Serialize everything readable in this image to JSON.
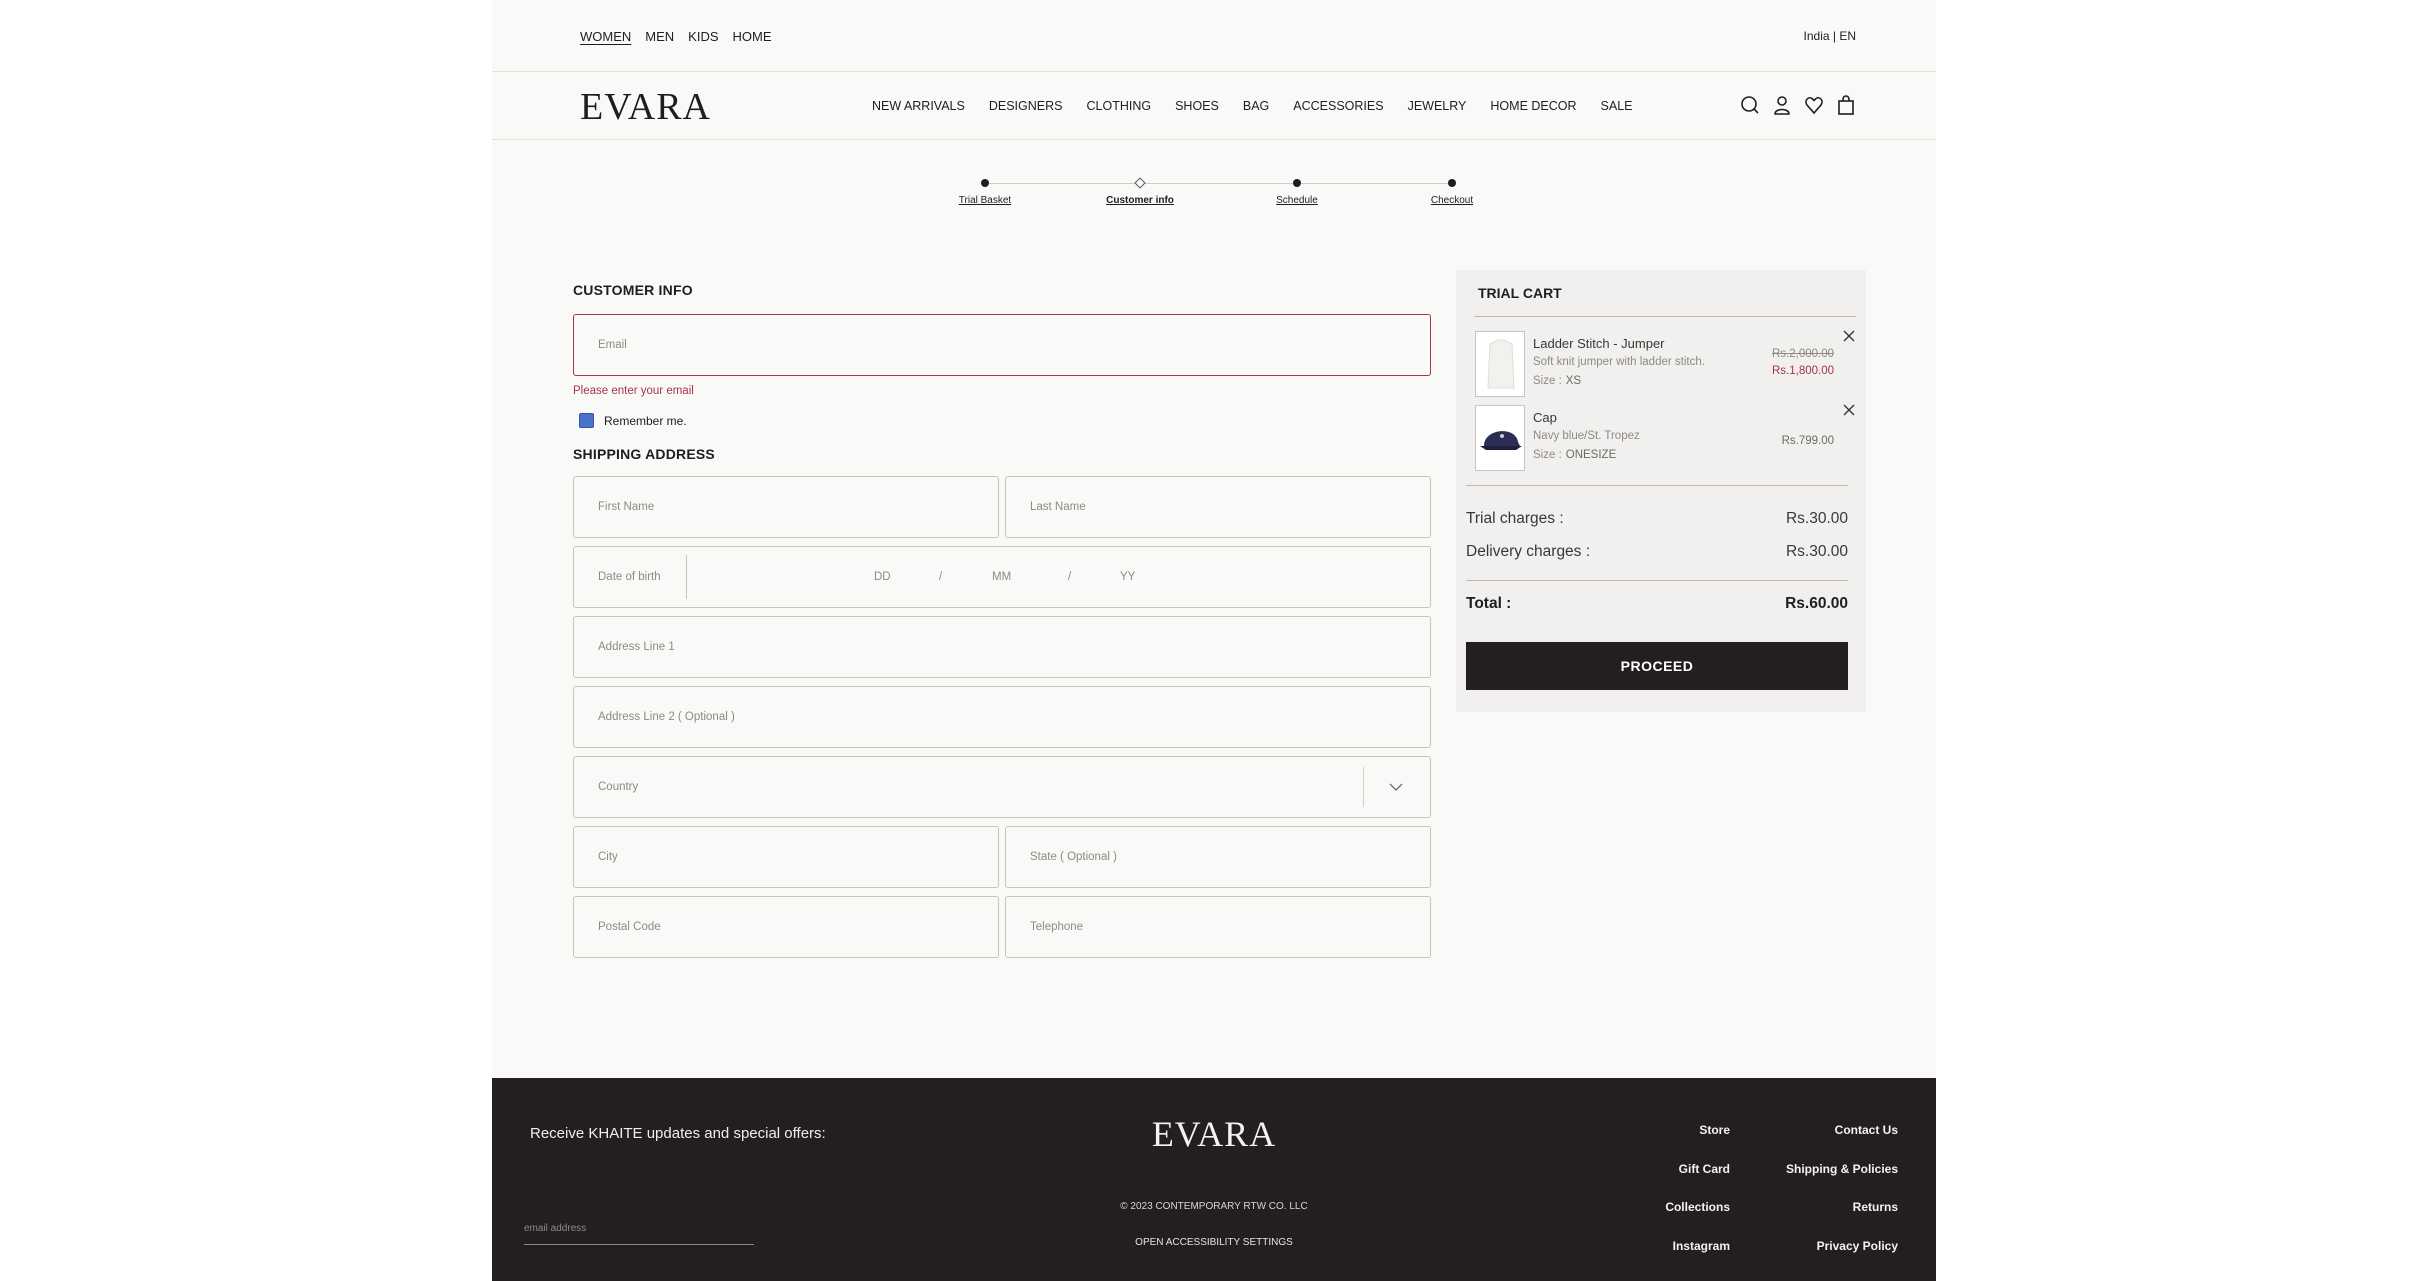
{
  "top_nav": {
    "genders": [
      "WOMEN",
      "MEN",
      "KIDS",
      "HOME"
    ],
    "active": "WOMEN",
    "locale": "India | EN"
  },
  "header": {
    "logo": "EVARA",
    "nav": [
      "NEW ARRIVALS",
      "DESIGNERS",
      "CLOTHING",
      "SHOES",
      "BAG",
      "ACCESSORIES",
      "JEWELRY",
      "HOME DECOR",
      "SALE"
    ],
    "icons": [
      "search-icon",
      "user-icon",
      "heart-icon",
      "bag-icon"
    ]
  },
  "stepper": {
    "steps": [
      "Trial Basket",
      "Customer info",
      "Schedule",
      "Checkout"
    ],
    "current": "Customer info"
  },
  "customer_info": {
    "title": "CUSTOMER INFO",
    "email_placeholder": "Email",
    "email_error": "Please enter your email",
    "remember_label": "Remember me."
  },
  "shipping": {
    "title": "SHIPPING ADDRESS",
    "first_name": "First Name",
    "last_name": "Last Name",
    "dob_label": "Date of birth",
    "dob_dd": "DD",
    "dob_mm": "MM",
    "dob_yy": "YY",
    "dob_sep": "/",
    "address1": "Address Line 1",
    "address2": "Address Line 2 ( Optional )",
    "country": "Country",
    "city": "City",
    "state": "State ( Optional )",
    "postal": "Postal Code",
    "telephone": "Telephone"
  },
  "cart": {
    "title": "TRIAL CART",
    "items": [
      {
        "name": "Ladder Stitch - Jumper",
        "desc": "Soft knit jumper with ladder stitch.",
        "size_label": "Size :",
        "size": "XS",
        "price_old": "Rs.2,000.00",
        "price_new": "Rs.1,800.00"
      },
      {
        "name": "Cap",
        "desc": "Navy blue/St. Tropez",
        "size_label": "Size :",
        "size": "ONESIZE",
        "price": "Rs.799.00"
      }
    ],
    "trial_label": "Trial charges :",
    "trial_value": "Rs.30.00",
    "delivery_label": "Delivery charges :",
    "delivery_value": "Rs.30.00",
    "total_label": "Total :",
    "total_value": "Rs.60.00",
    "proceed": "PROCEED"
  },
  "footer": {
    "offer": "Receive KHAITE updates and special offers:",
    "email_placeholder": "email address",
    "logo": "EVARA",
    "copyright": "© 2023 CONTEMPORARY RTW CO. LLC",
    "accessibility": "OPEN ACCESSIBILITY SETTINGS",
    "links_col1": [
      "Store",
      "Gift Card",
      "Collections",
      "Instagram"
    ],
    "links_col2": [
      "Contact Us",
      "Shipping & Policies",
      "Returns",
      "Privacy Policy"
    ]
  },
  "colors": {
    "accent_error": "#a8324f",
    "dark": "#231f20",
    "checkbox": "#4a74c9"
  }
}
